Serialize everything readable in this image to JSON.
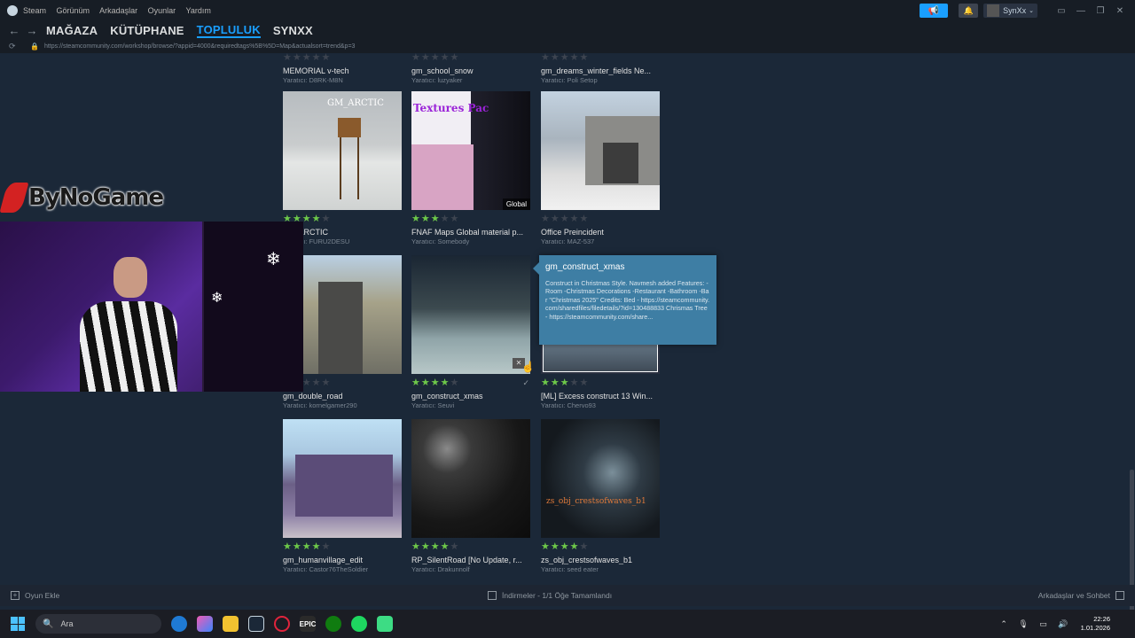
{
  "titlebar": {
    "menu": [
      "Steam",
      "Görünüm",
      "Arkadaşlar",
      "Oyunlar",
      "Yardım"
    ],
    "username": "SynXx"
  },
  "nav": {
    "tabs": [
      "MAĞAZA",
      "KÜTÜPHANE",
      "TOPLULUK",
      "SYNXX"
    ],
    "active_tab": "TOPLULUK",
    "url": "https://steamcommunity.com/workshop/browse/?appid=4000&requiredtags%5B%5D=Map&actualsort=trend&p=3"
  },
  "top_row": [
    {
      "name": "MEMORIAL v-tech",
      "author": "Yaratıcı: D8RK-M8N"
    },
    {
      "name": "gm_school_snow",
      "author": "Yaratıcı: luzyaker"
    },
    {
      "name": "gm_dreams_winter_fields Ne...",
      "author": "Yaratıcı: Poli Setop"
    }
  ],
  "items": [
    {
      "name": "gm_ARCTIC",
      "author": "Yaratıcı: FURU2DESU",
      "rating": 4,
      "thumb_text": "GM_ARCTIC"
    },
    {
      "name": "FNAF Maps Global material p...",
      "author": "Yaratıcı: Somebody",
      "rating": 3,
      "thumb_text": "Textures Pac",
      "badge": "Global"
    },
    {
      "name": "Office Preincident",
      "author": "Yaratıcı: MAZ-537",
      "rating": 0
    },
    {
      "name": "gm_double_road",
      "author": "Yaratıcı: kornelgamer290",
      "rating": 0
    },
    {
      "name": "gm_construct_xmas",
      "author": "Yaratıcı: Seuvi",
      "rating": 4
    },
    {
      "name": "[ML] Excess construct 13 Win...",
      "author": "Yaratıcı: Chervo93",
      "rating": 3
    },
    {
      "name": "gm_humanvillage_edit",
      "author": "Yaratıcı: Castor76TheSoldier",
      "rating": 4
    },
    {
      "name": "RP_SilentRoad [No Update, r...",
      "author": "Yaratıcı: Drakunnolf",
      "rating": 4
    },
    {
      "name": "zs_obj_crestsofwaves_b1",
      "author": "Yaratıcı: seed eater",
      "rating": 4,
      "thumb_text": "zs_obj_crestsofwaves_b1"
    }
  ],
  "tooltip": {
    "title": "gm_construct_xmas",
    "description": "Construct in Christmas Style. Navmesh added Features: -Room -Christmas Decorations -Restaurant -Bathroom -Bar \"Christmas 2025\" Credits: Bed - https://steamcommunity.com/sharedfiles/filedetails/?id=130488833 Chrismas Tree - https://steamcommunity.com/share..."
  },
  "overlay": {
    "logo_text": "ByNoGame"
  },
  "bottombar": {
    "add_game": "Oyun Ekle",
    "downloads": "İndirmeler - 1/1 Öğe Tamamlandı",
    "friends": "Arkadaşlar ve Sohbet"
  },
  "taskbar": {
    "search_placeholder": "Ara",
    "time": "22:26",
    "date": "1.01.2026"
  },
  "colors": {
    "accent": "#1a9fff",
    "background": "#1b2838",
    "star": "#6dc849",
    "tooltip": "#3e7ea4"
  }
}
